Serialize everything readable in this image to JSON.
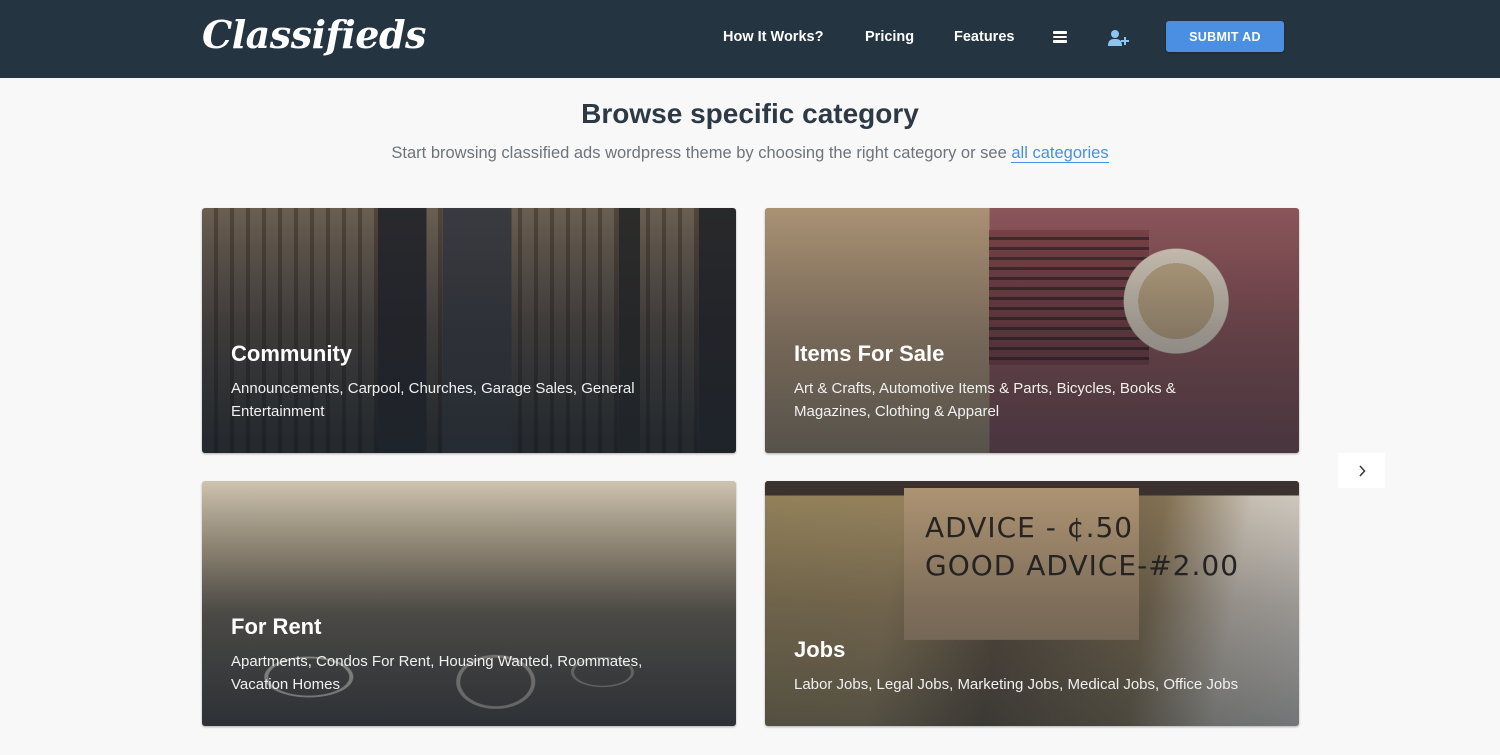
{
  "header": {
    "logo_text": "Classifieds",
    "nav": [
      {
        "label": "How It Works?"
      },
      {
        "label": "Pricing"
      },
      {
        "label": "Features"
      }
    ],
    "menu_icon": "hamburger-menu-icon",
    "user_icon": "user-add-icon",
    "submit_button_label": "SUBMIT AD"
  },
  "section": {
    "title": "Browse specific category",
    "subtitle": "Start browsing classified ads wordpress theme by choosing the right category or see ",
    "link_label": "all categories"
  },
  "categories": [
    {
      "title": "Community",
      "description": "Announcements, Carpool, Churches, Garage Sales, General Entertainment"
    },
    {
      "title": "Items For Sale",
      "description": "Art & Crafts, Automotive Items & Parts, Bicycles, Books & Magazines, Clothing & Apparel"
    },
    {
      "title": "For Rent",
      "description": "Apartments, Condos For Rent, Housing Wanted, Roommates, Vacation Homes"
    },
    {
      "title": "Jobs",
      "description": "Labor Jobs, Legal Jobs, Marketing Jobs, Medical Jobs, Office Jobs",
      "image_sign_text": [
        "ADVICE - ¢.50",
        "GOOD ADVICE-#2.00"
      ]
    }
  ],
  "carousel": {
    "next_icon": "chevron-right-icon"
  },
  "colors": {
    "header_bg": "#253441",
    "accent": "#4a8fe2",
    "page_bg": "#f8f8f8",
    "heading": "#2d3a45",
    "muted_text": "#6d747b"
  }
}
